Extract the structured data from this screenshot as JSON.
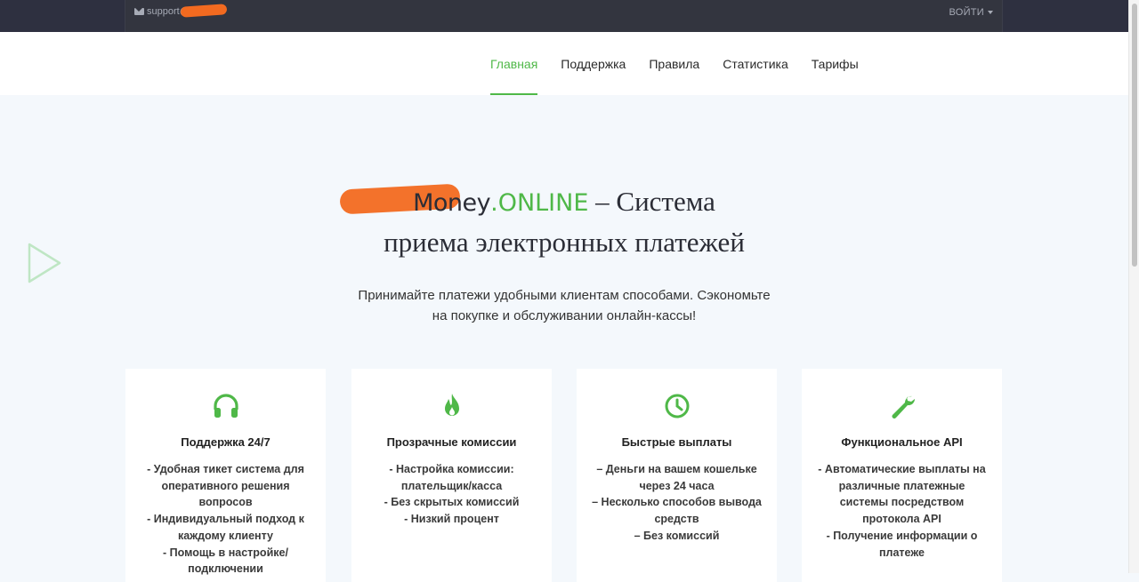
{
  "topbar": {
    "support_text": "support@",
    "login_label": "ВОЙТИ"
  },
  "nav": {
    "items": [
      {
        "label": "Главная",
        "active": true
      },
      {
        "label": "Поддержка"
      },
      {
        "label": "Правила"
      },
      {
        "label": "Статистика"
      },
      {
        "label": "Тарифы"
      }
    ]
  },
  "hero": {
    "brand_name": "Money",
    "brand_suffix": ".ONLINE",
    "title_rest_line1": " – Система",
    "title_line2": "приема электронных платежей",
    "subtitle_line1": "Принимайте платежи удобными клиентам способами. Сэкономьте",
    "subtitle_line2": "на покупке и обслуживании онлайн-кассы!"
  },
  "features": [
    {
      "icon": "headphones-icon",
      "title": "Поддержка 24/7",
      "lines": [
        "- Удобная тикет система для",
        "оперативного решения",
        "вопросов",
        "- Индивидуальный подход к",
        "каждому клиенту",
        "- Помощь в настройке/",
        "подключении"
      ]
    },
    {
      "icon": "fire-icon",
      "title": "Прозрачные комиссии",
      "lines": [
        "- Настройка комиссии:",
        "плательщик/касса",
        "- Без скрытых комиссий",
        "- Низкий процент"
      ]
    },
    {
      "icon": "clock-icon",
      "title": "Быстрые выплаты",
      "lines": [
        "– Деньги на вашем кошельке",
        "через 24 часа",
        "– Несколько способов вывода",
        "средств",
        "– Без комиссий"
      ]
    },
    {
      "icon": "wrench-icon",
      "title": "Функциональное API",
      "lines": [
        "- Автоматические выплаты на",
        "различные платежные",
        "системы посредством",
        "протокола API",
        "- Получение информации о",
        "платеже"
      ]
    }
  ],
  "colors": {
    "accent": "#4fb848",
    "topbar": "#33353f",
    "page_bg": "#f4f8fc"
  }
}
